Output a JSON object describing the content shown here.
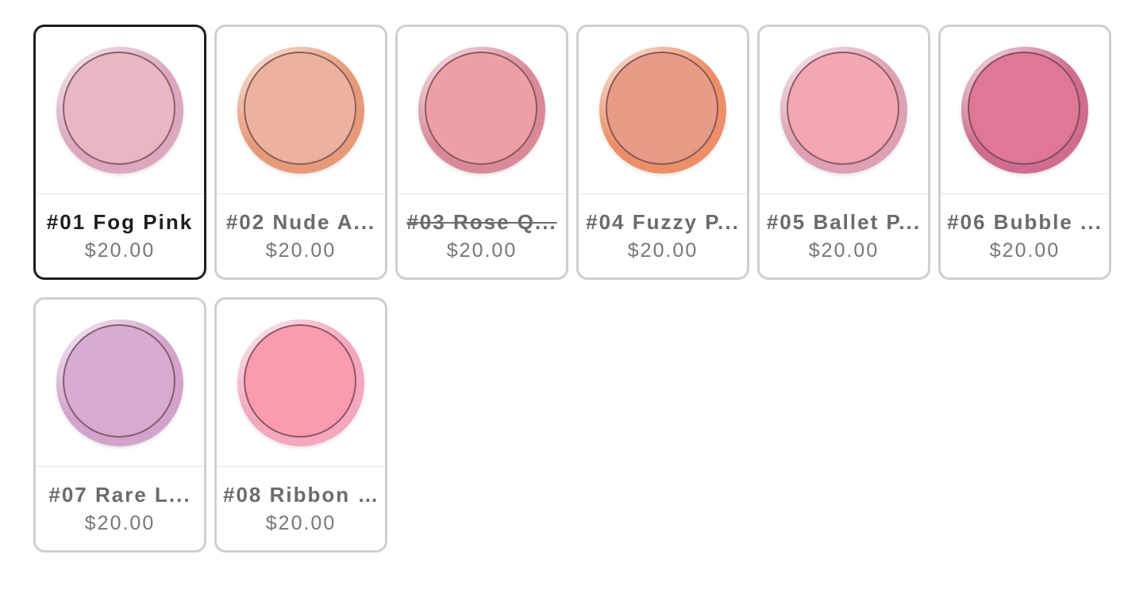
{
  "swatches": [
    {
      "name": "#01 Fog Pink",
      "price": "$20.00",
      "selected": true,
      "available": true,
      "rim": "#dba8bf",
      "powder": "#e9b6c3"
    },
    {
      "name": "#02 Nude A...",
      "price": "$20.00",
      "selected": false,
      "available": true,
      "rim": "#e79a78",
      "powder": "#ecb29d"
    },
    {
      "name": "#03 Rose Q...",
      "price": "$20.00",
      "selected": false,
      "available": false,
      "rim": "#d98a98",
      "powder": "#ee9fa6"
    },
    {
      "name": "#04 Fuzzy P...",
      "price": "$20.00",
      "selected": false,
      "available": true,
      "rim": "#ec8f68",
      "powder": "#e89c88"
    },
    {
      "name": "#05 Ballet P...",
      "price": "$20.00",
      "selected": false,
      "available": true,
      "rim": "#dea0b3",
      "powder": "#f2a7b3"
    },
    {
      "name": "#06 Bubble ...",
      "price": "$20.00",
      "selected": false,
      "available": true,
      "rim": "#cf6d91",
      "powder": "#de7896"
    },
    {
      "name": "#07 Rare L...",
      "price": "$20.00",
      "selected": false,
      "available": true,
      "rim": "#d3a3cb",
      "powder": "#d8abd3"
    },
    {
      "name": "#08 Ribbon ...",
      "price": "$20.00",
      "selected": false,
      "available": true,
      "rim": "#f5a7be",
      "powder": "#fa9bb0"
    }
  ]
}
